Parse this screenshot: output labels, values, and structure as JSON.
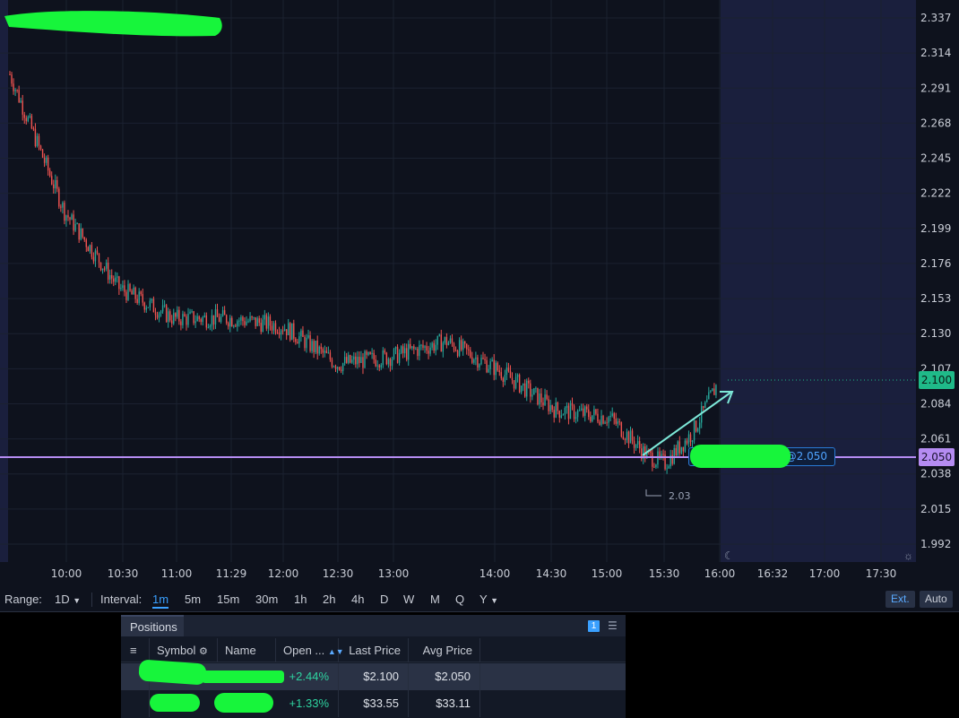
{
  "chart": {
    "price_axis_ticks": [
      "2.337",
      "2.314",
      "2.291",
      "2.268",
      "2.245",
      "2.222",
      "2.199",
      "2.176",
      "2.153",
      "2.130",
      "2.107",
      "2.084",
      "2.061",
      "2.038",
      "2.015",
      "1.992"
    ],
    "time_axis_ticks": [
      "10:00",
      "10:30",
      "11:00",
      "11:29",
      "12:00",
      "12:30",
      "13:00",
      "14:00",
      "14:30",
      "15:00",
      "15:30",
      "16:00",
      "16:32",
      "17:00",
      "17:30"
    ],
    "last_price": "2.100",
    "avg_price_line": "2.050",
    "avg_price_label": "@2.050",
    "low_marker": "2.03",
    "colors": {
      "up": "#26a69a",
      "down": "#ef5350",
      "avg_line": "#b58cf2",
      "last_price": "#1fba89",
      "extended_hours_bg": "#1a1f3d"
    }
  },
  "chart_data": {
    "type": "candlestick",
    "title": "",
    "xlabel": "",
    "ylabel": "",
    "ylim": [
      1.992,
      2.337
    ],
    "x": [
      "09:30",
      "10:00",
      "10:30",
      "11:00",
      "11:30",
      "12:00",
      "12:30",
      "13:00",
      "13:30",
      "14:00",
      "14:30",
      "15:00",
      "15:20",
      "15:30",
      "15:45",
      "16:00"
    ],
    "close": [
      2.3,
      2.21,
      2.16,
      2.14,
      2.14,
      2.135,
      2.11,
      2.115,
      2.125,
      2.105,
      2.08,
      2.075,
      2.05,
      2.045,
      2.065,
      2.1
    ],
    "horizontal_lines": [
      {
        "value": 2.05,
        "label": "@2.050"
      }
    ],
    "annotations": [
      {
        "x": "15:20",
        "y": 2.03,
        "text": "2.03"
      }
    ]
  },
  "toolbar": {
    "range_label": "Range:",
    "range_value": "1D",
    "interval_label": "Interval:",
    "intervals": [
      "1m",
      "5m",
      "15m",
      "30m",
      "1h",
      "2h",
      "4h",
      "D",
      "W",
      "M",
      "Q",
      "Y"
    ],
    "active_interval": "1m",
    "ext_label": "Ext.",
    "auto_label": "Auto"
  },
  "positions": {
    "tab_label": "Positions",
    "badge": "1",
    "columns": [
      "Symbol",
      "Name",
      "Open ...",
      "Last Price",
      "Avg Price"
    ],
    "rows": [
      {
        "open_pl": "+2.44%",
        "last_price": "$2.100",
        "avg_price": "$2.050"
      },
      {
        "open_pl": "+1.33%",
        "last_price": "$33.55",
        "avg_price": "$33.11"
      }
    ]
  }
}
